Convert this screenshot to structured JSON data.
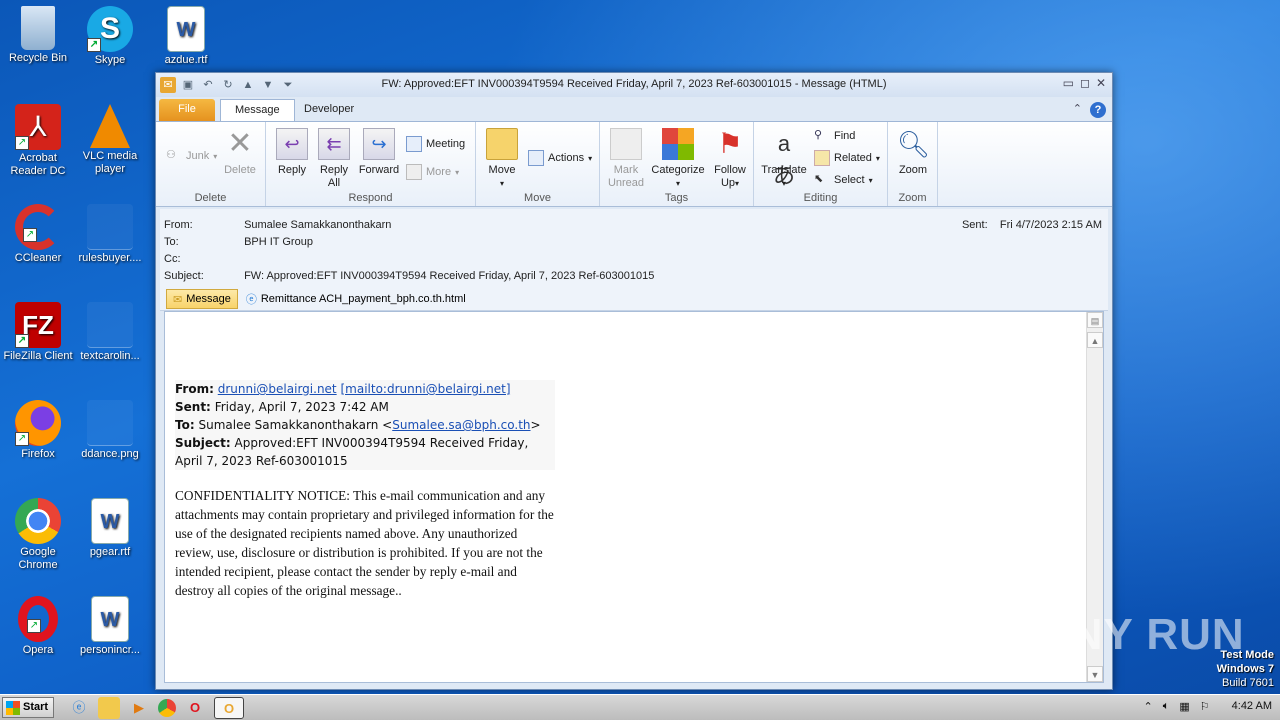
{
  "desktop": {
    "icons": [
      {
        "label": "Recycle Bin"
      },
      {
        "label": "Skype"
      },
      {
        "label": "azdue.rtf"
      },
      {
        "label": "Acrobat Reader DC"
      },
      {
        "label": "VLC media player"
      },
      {
        "label": "CCleaner"
      },
      {
        "label": "rulesbuyer...."
      },
      {
        "label": "FileZilla Client"
      },
      {
        "label": "textcarolin..."
      },
      {
        "label": "Firefox"
      },
      {
        "label": "ddance.png"
      },
      {
        "label": "Google Chrome"
      },
      {
        "label": "pgear.rtf"
      },
      {
        "label": "Opera"
      },
      {
        "label": "personincr..."
      }
    ]
  },
  "window": {
    "title": "FW: Approved:EFT INV000394T9594 Received Friday, April 7, 2023 Ref-603001015  -  Message (HTML)",
    "tabs": {
      "file": "File",
      "message": "Message",
      "developer": "Developer"
    },
    "ribbon": {
      "delete_group": {
        "label": "Delete",
        "junk": "Junk",
        "delete": "Delete"
      },
      "respond_group": {
        "label": "Respond",
        "reply": "Reply",
        "reply_all_1": "Reply",
        "reply_all_2": "All",
        "forward": "Forward",
        "meeting": "Meeting",
        "more": "More"
      },
      "move_group": {
        "label": "Move",
        "move": "Move",
        "actions": "Actions"
      },
      "tags_group": {
        "label": "Tags",
        "mark_unread_1": "Mark",
        "mark_unread_2": "Unread",
        "categorize": "Categorize",
        "follow_up_1": "Follow",
        "follow_up_2": "Up"
      },
      "editing_group": {
        "label": "Editing",
        "translate": "Translate",
        "find": "Find",
        "related": "Related",
        "select": "Select"
      },
      "zoom_group": {
        "label": "Zoom",
        "zoom": "Zoom"
      }
    },
    "header": {
      "from_label": "From:",
      "from": "Sumalee Samakkanonthakarn",
      "to_label": "To:",
      "to": "BPH IT Group",
      "cc_label": "Cc:",
      "cc": "",
      "subject_label": "Subject:",
      "subject": "FW: Approved:EFT INV000394T9594 Received Friday, April 7, 2023 Ref-603001015",
      "sent_label": "Sent:",
      "sent": "Fri 4/7/2023 2:15 AM",
      "attachments": [
        {
          "name": "Message"
        },
        {
          "name": "Remittance ACH_payment_bph.co.th.html"
        }
      ]
    },
    "body": {
      "from_label": "From:",
      "from_email": "drunni@belairgi.net",
      "from_mailto": "[mailto:drunni@belairgi.net]",
      "sent_label": "Sent:",
      "sent": "Friday, April 7, 2023 7:42 AM",
      "to_label": "To:",
      "to_name": "Sumalee Samakkanonthakarn <",
      "to_email": "Sumalee.sa@bph.co.th",
      "to_close": ">",
      "subject_label": "Subject:",
      "subject": "Approved:EFT INV000394T9594 Received Friday, April 7, 2023 Ref-603001015",
      "notice": "CONFIDENTIALITY NOTICE: This e-mail communication and any attachments may contain proprietary and privileged information for the use of the designated recipients named above. Any unauthorized review, use, disclosure or distribution is prohibited. If you are not the intended recipient, please contact the sender by reply e-mail and destroy all copies of the original message.."
    }
  },
  "watermark": "ANY RUN",
  "test_mode": {
    "line1": "Test Mode",
    "line2": "Windows 7",
    "line3": "Build 7601"
  },
  "taskbar": {
    "start": "Start",
    "clock": "4:42 AM"
  }
}
